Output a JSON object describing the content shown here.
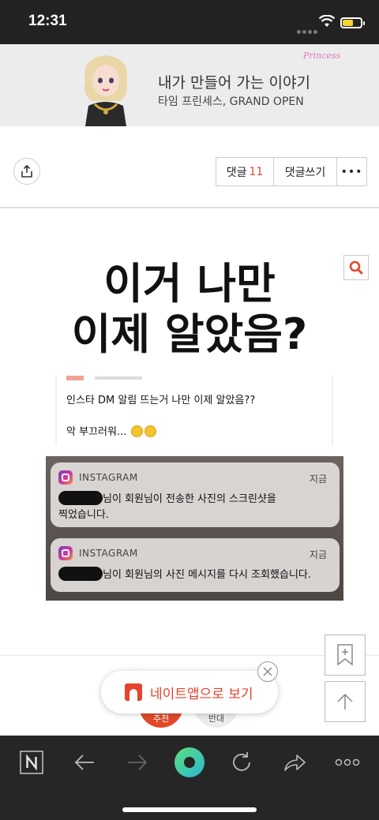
{
  "status_bar": {
    "time": "12:31",
    "battery_level": 0.6
  },
  "banner": {
    "logo_text": "Princess",
    "title": "내가 만들어 가는 이야기",
    "subtitle": "타임 프린세스, GRAND OPEN"
  },
  "article_actions": {
    "share_icon": "share-icon",
    "comment_label": "댓글",
    "comment_count": "11",
    "write_comment_label": "댓글쓰기",
    "more_label": "•••"
  },
  "content": {
    "headline_line1": "이거 나만",
    "headline_line2": "이제 알았음?",
    "dm_card": {
      "line1": "인스타 DM 알림 뜨는거 나만 이제 알았음??",
      "line2": "악 부끄러워..."
    },
    "notifications": [
      {
        "app": "INSTAGRAM",
        "time": "지금",
        "body_line1": "님이 회원님이 전송한 사진의 스크린샷을",
        "body_line2": "찍었습니다."
      },
      {
        "app": "INSTAGRAM",
        "time": "지금",
        "body_line1": "님이 회원님의 사진 메시지를 다시 조회했습니다."
      }
    ]
  },
  "vote": {
    "recommend_label": "추천",
    "oppose_label": "반대"
  },
  "popup": {
    "text": "네이트앱으로 보기"
  },
  "colors": {
    "accent": "#e8412c",
    "bottom_bar": "#262626",
    "status_bar": "#222222"
  }
}
